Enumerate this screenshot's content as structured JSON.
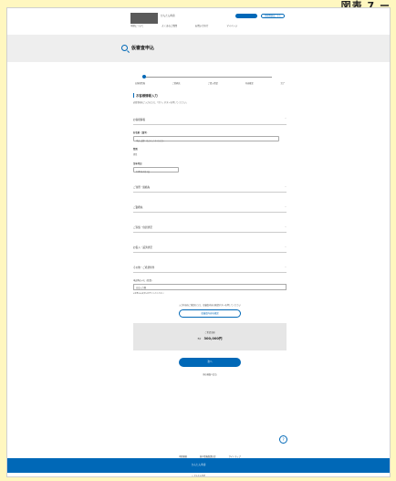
{
  "frame_label": "図表 7 ー",
  "header": {
    "logo_text": "かんたん申請",
    "login_label": "ログイン",
    "register_label": "新規登録はこちら",
    "nav": [
      "申請について",
      "よくあるご質問",
      "お問い合わせ",
      "マイページ"
    ]
  },
  "page_title": "仮審査申込",
  "stepper": {
    "steps": [
      "お客様情報",
      "ご勤務先",
      "ご借入希望",
      "内容確認",
      "完了"
    ],
    "active_index": 0
  },
  "form": {
    "heading": "お客様情報入力",
    "description": "必要事項をご入力のうえ、「次へ」ボタンを押してください。",
    "open_section": "お客様情報",
    "fields": [
      {
        "label": "お名前（漢字）",
        "value": "申込 太郎（もうしこみ たろう）"
      },
      {
        "label": "性別",
        "value": "男性"
      },
      {
        "label": "生年月日",
        "value": "1980年1月1日"
      }
    ],
    "collapsed_sections": [
      "ご住所・連絡先",
      "ご勤務先",
      "ご家族・住居状況",
      "お借入・返済状況",
      "その他・ご希望条件"
    ],
    "note_label": "申込時のメモ（任意）",
    "note_value": "自由入力欄",
    "note_hint": "※全角100文字以内でご入力ください",
    "confirm_text": "入力内容をご確認のうえ、仮審査内容の確認ボタンを押してください",
    "confirm_button": "仮審査内容を確認",
    "summary_label": "ご希望金額",
    "summary_prefix": "合計",
    "summary_value": "300,000円",
    "next_button": "次へ",
    "back_link": "前の画面へ戻る"
  },
  "footer": {
    "help_icon_label": "?",
    "links": [
      "利用規約",
      "個人情報保護方針",
      "サイトマップ"
    ],
    "bar_text": "かんたん申請",
    "copyright": "© かんたん申請"
  }
}
